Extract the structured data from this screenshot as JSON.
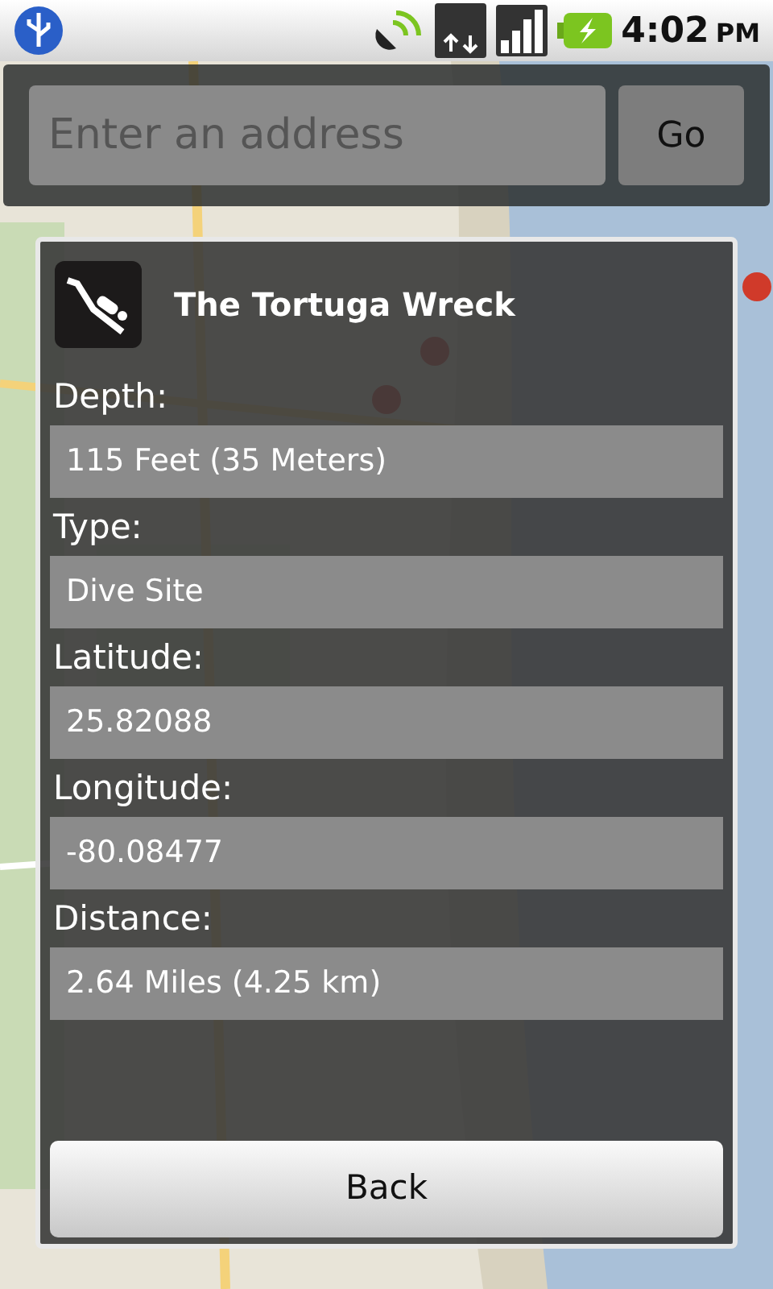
{
  "status_bar": {
    "time": "4:02",
    "period": "PM"
  },
  "search": {
    "placeholder": "Enter an address",
    "button": "Go"
  },
  "dialog": {
    "title": "The Tortuga Wreck",
    "fields": [
      {
        "label": "Depth:",
        "value": "115 Feet (35 Meters)"
      },
      {
        "label": "Type:",
        "value": "Dive Site"
      },
      {
        "label": "Latitude:",
        "value": "25.82088"
      },
      {
        "label": "Longitude:",
        "value": "-80.08477"
      },
      {
        "label": "Distance:",
        "value": "2.64 Miles (4.25 km)"
      }
    ],
    "button": "Back"
  }
}
